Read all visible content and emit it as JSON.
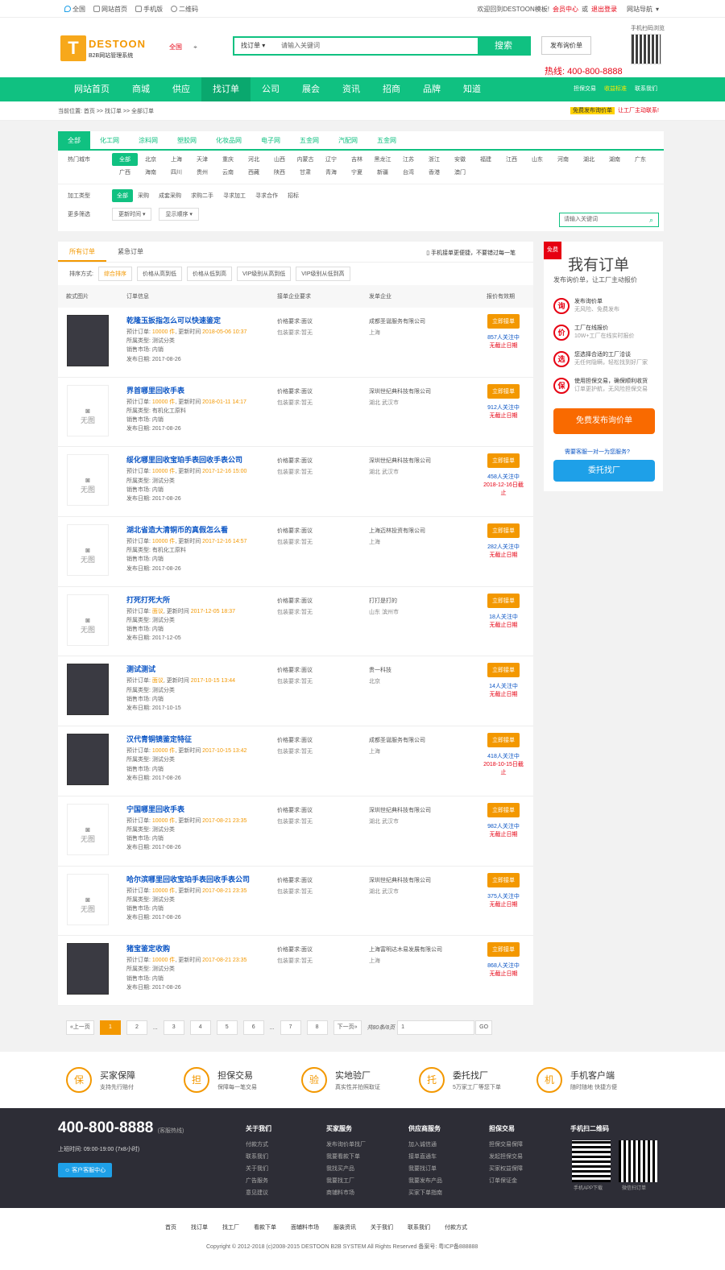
{
  "topbar": {
    "links": [
      "全国",
      "网站首页",
      "手机版",
      "二维码"
    ],
    "welcome": "欢迎回到DESTOON模板!",
    "member": "会员中心",
    "or": "或",
    "logout": "退出登录",
    "sitenav": "网站导航"
  },
  "header": {
    "logo_mark": "T",
    "logo_name": "DESTOON",
    "logo_sub": "B2B网站管理系统",
    "city": "全国",
    "search_type": "找订单",
    "search_placeholder": "请输入关键词",
    "search_btn": "搜索",
    "post_btn": "发布询价单",
    "hotline": "热线: 400-800-8888",
    "qr_label": "手机扫码浏览"
  },
  "nav": {
    "items": [
      "网站首页",
      "商城",
      "供应",
      "找订单",
      "公司",
      "展会",
      "资讯",
      "招商",
      "品牌",
      "知道"
    ],
    "active": 3,
    "right": [
      "担保交易",
      "收益标准",
      "联系我们"
    ]
  },
  "crumb": {
    "text": "当前位置: 首页 >> 找订单 >> 全部订单",
    "badge": "免费发布询价单",
    "tip": "让工厂主动联系!"
  },
  "filter": {
    "tabs": [
      "全部",
      "化工网",
      "涂料网",
      "塑胶网",
      "化妆品网",
      "电子网",
      "五金网",
      "汽配网",
      "五金网"
    ],
    "city_label": "热门城市",
    "cities": [
      "全部",
      "北京",
      "上海",
      "天津",
      "重庆",
      "河北",
      "山西",
      "内蒙古",
      "辽宁",
      "吉林",
      "黑龙江",
      "江苏",
      "浙江",
      "安徽",
      "福建",
      "江西",
      "山东",
      "河南",
      "湖北",
      "湖南",
      "广东",
      "广西",
      "海南",
      "四川",
      "贵州",
      "云南",
      "西藏",
      "陕西",
      "甘肃",
      "青海",
      "宁夏",
      "新疆",
      "台湾",
      "香港",
      "澳门"
    ],
    "type_label": "加工类型",
    "types": [
      "全部",
      "采购",
      "成套采购",
      "求购二手",
      "寻求加工",
      "寻求合作",
      "招标"
    ],
    "more_label": "更多筛选",
    "sel1": "更新时间",
    "sel2": "显示顺序",
    "search_placeholder": "请输入关键词"
  },
  "list": {
    "tabs": [
      "所有订单",
      "紧急订单"
    ],
    "mobile_tip": "手机接单更便捷，不要错过每一笔",
    "sort_label": "排序方式:",
    "sorts": [
      "综合排序",
      "价格从高到低",
      "价格从低到高",
      "VIP级别从高到低",
      "VIP级别从低到高"
    ],
    "headers": [
      "款式图片",
      "订单信息",
      "接单企业要求",
      "发单企业",
      "报价有效期"
    ],
    "btn": "立即接单",
    "no_img": "无图",
    "rows": [
      {
        "title": "乾隆玉扳指怎么可以快速鉴定",
        "qty": "10000 件",
        "upd": "2018-05-06 10:37",
        "cat": "测试分类",
        "market": "内销",
        "date": "2017-08-26",
        "req1": "价格要求:面议",
        "req2": "包装要求:暂无",
        "comp": "成都圣诞服务有限公司",
        "loc": "上海",
        "cnt": "857人关注中",
        "exp": "无截止日期",
        "img": true
      },
      {
        "title": "界首哪里回收手表",
        "qty": "10000 件",
        "upd": "2018-01-11 14:17",
        "cat": "有机化工原料",
        "market": "内销",
        "date": "2017-08-26",
        "req1": "价格要求:面议",
        "req2": "包装要求:暂无",
        "comp": "深圳世纪典科技有限公司",
        "loc": "湖北 武汉市",
        "cnt": "912人关注中",
        "exp": "无截止日期",
        "img": false
      },
      {
        "title": "绥化哪里回收宝珀手表回收手表公司",
        "qty": "10000 件",
        "upd": "2017-12-16 15:00",
        "cat": "测试分类",
        "market": "内销",
        "date": "2017-08-26",
        "req1": "价格要求:面议",
        "req2": "包装要求:暂无",
        "comp": "深圳世纪典科技有限公司",
        "loc": "湖北 武汉市",
        "cnt": "458人关注中",
        "exp": "2018-12-16日截止",
        "img": false
      },
      {
        "title": "湖北省造大清铜币的真假怎么看",
        "qty": "10000 件",
        "upd": "2017-12-16 14:57",
        "cat": "有机化工原料",
        "market": "内销",
        "date": "2017-08-26",
        "req1": "价格要求:面议",
        "req2": "包装要求:暂无",
        "comp": "上海迈林投资有限公司",
        "loc": "上海",
        "cnt": "282人关注中",
        "exp": "无截止日期",
        "img": false
      },
      {
        "title": "打死打死大所",
        "qty": "面议",
        "upd": "2017-12-05 18:37",
        "cat": "测试分类",
        "market": "内销",
        "date": "2017-12-05",
        "req1": "价格要求:面议",
        "req2": "包装要求:暂无",
        "comp": "打打是打的",
        "loc": "山东 滨州市",
        "cnt": "18人关注中",
        "exp": "无截止日期",
        "img": false
      },
      {
        "title": "测试测试",
        "qty": "面议",
        "upd": "2017-10-15 13:44",
        "cat": "测试分类",
        "market": "内销",
        "date": "2017-10-15",
        "req1": "价格要求:面议",
        "req2": "包装要求:暂无",
        "comp": "贵一科技",
        "loc": "北京",
        "cnt": "14人关注中",
        "exp": "无截止日期",
        "img": true
      },
      {
        "title": "汉代青铜镜鉴定特征",
        "qty": "10000 件",
        "upd": "2017-10-15 13:42",
        "cat": "测试分类",
        "market": "内销",
        "date": "2017-08-26",
        "req1": "价格要求:面议",
        "req2": "包装要求:暂无",
        "comp": "成都圣诞服务有限公司",
        "loc": "上海",
        "cnt": "418人关注中",
        "exp": "2018-10-15日截止",
        "img": true
      },
      {
        "title": "宁国哪里回收手表",
        "qty": "10000 件",
        "upd": "2017-08-21 23:35",
        "cat": "测试分类",
        "market": "内销",
        "date": "2017-08-26",
        "req1": "价格要求:面议",
        "req2": "包装要求:暂无",
        "comp": "深圳世纪典科技有限公司",
        "loc": "湖北 武汉市",
        "cnt": "982人关注中",
        "exp": "无截止日期",
        "img": false
      },
      {
        "title": "哈尔滨哪里回收宝珀手表回收手表公司",
        "qty": "10000 件",
        "upd": "2017-08-21 23:35",
        "cat": "测试分类",
        "market": "内销",
        "date": "2017-08-26",
        "req1": "价格要求:面议",
        "req2": "包装要求:暂无",
        "comp": "深圳世纪典科技有限公司",
        "loc": "湖北 武汉市",
        "cnt": "375人关注中",
        "exp": "无截止日期",
        "img": false
      },
      {
        "title": "猪宝鉴定收购",
        "qty": "10000 件",
        "upd": "2017-08-21 23:35",
        "cat": "测试分类",
        "market": "内销",
        "date": "2017-08-26",
        "req1": "价格要求:面议",
        "req2": "包装要求:暂无",
        "comp": "上海富明达木易发展有限公司",
        "loc": "上海",
        "cnt": "868人关注中",
        "exp": "无截止日期",
        "img": true
      }
    ],
    "meta_labels": {
      "qty": "预计订单: ",
      "upd": ", 更新时间 ",
      "cat": "所属类型: ",
      "market": "销售市场: ",
      "date": "发布日期: "
    }
  },
  "pager": {
    "prev": "«上一页",
    "pages": [
      "1",
      "2",
      "...",
      "3",
      "4",
      "5",
      "6",
      "...",
      "7",
      "8"
    ],
    "next": "下一页»",
    "total": "共80条/8页",
    "go": "GO",
    "input": "1"
  },
  "side": {
    "tag": "免费",
    "title": "我有订单",
    "sub": "发布询价单，让工厂主动报价",
    "items": [
      {
        "icon": "询",
        "t": "发布询价单",
        "s": "无风险、免费发布"
      },
      {
        "icon": "价",
        "t": "工厂在线报价",
        "s": "10W+工厂在线实时报价"
      },
      {
        "icon": "选",
        "t": "您选择合适的工厂洽谈",
        "s": "无任何隐瞒，轻松找到好厂家"
      },
      {
        "icon": "保",
        "t": "使用担保交易，确保顺利收货",
        "s": "订单更护航，无风险担保交易"
      }
    ],
    "btn1": "免费发布询价单",
    "q": "需要客服一对一为您服务?",
    "btn2": "委托找厂"
  },
  "guar": [
    {
      "icon": "保",
      "t": "买家保障",
      "s": "支持先行赔付"
    },
    {
      "icon": "担",
      "t": "担保交易",
      "s": "保障每一笔交易"
    },
    {
      "icon": "验",
      "t": "实地验厂",
      "s": "真实性并拍照取证"
    },
    {
      "icon": "托",
      "t": "委托找厂",
      "s": "5万家工厂等您下单"
    },
    {
      "icon": "机",
      "t": "手机客户端",
      "s": "随时随地 快捷方便"
    }
  ],
  "footer": {
    "phone": "400-800-8888",
    "phone_note": "(客服热线)",
    "hours": "上班时间: 09:00-19:00 (7x8小时)",
    "kf": "客户客服中心",
    "cols": [
      {
        "h": "关于我们",
        "i": [
          "付款方式",
          "联系我们",
          "关于我们",
          "广告服务",
          "意见建议"
        ]
      },
      {
        "h": "买家服务",
        "i": [
          "发布询价单找厂",
          "我要看款下单",
          "我找买产品",
          "我要找工厂",
          "商铺料市场"
        ]
      },
      {
        "h": "供应商服务",
        "i": [
          "加入诚信通",
          "接单直通车",
          "我要找订单",
          "我要发布产品",
          "买家下单指南"
        ]
      },
      {
        "h": "担保交易",
        "i": [
          "担保交易保障",
          "发起担保交易",
          "买家权益保障",
          "订单保证金"
        ]
      }
    ],
    "qr_title": "手机扫二维码",
    "qr1": "手机APP下载",
    "qr2": "微信扫订单"
  },
  "bottom": {
    "links": [
      "首页",
      "找订单",
      "找工厂",
      "看款下单",
      "面辅料市场",
      "服装资讯",
      "关于我们",
      "联系我们",
      "付款方式"
    ],
    "copy": "Copyright © 2012-2018 (c)2008-2015 DESTOON B2B SYSTEM All Rights Reserved  备案号: 粤ICP备888888"
  }
}
